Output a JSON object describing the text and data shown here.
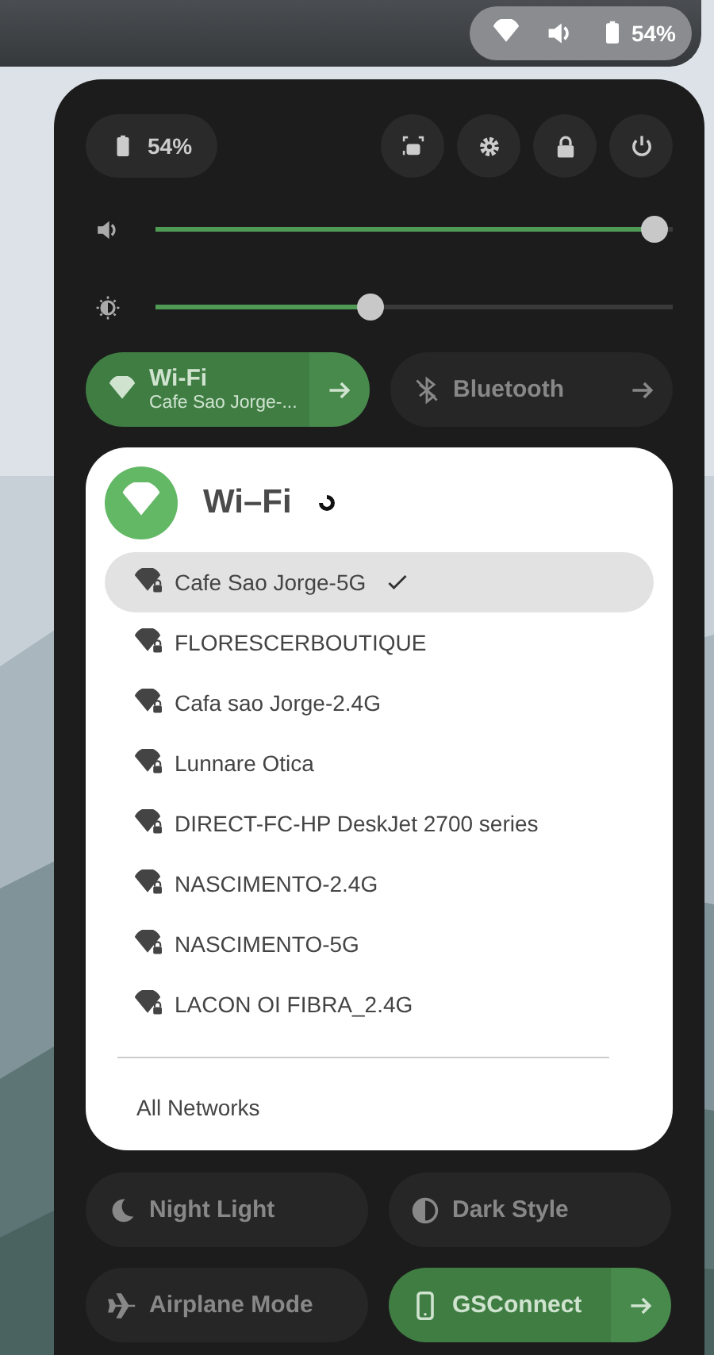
{
  "top_bar": {
    "battery": "54%"
  },
  "panel": {
    "battery": "54%",
    "volume": {
      "level": 0.99
    },
    "brightness": {
      "level": 0.41
    },
    "toggles": [
      {
        "kind": "menu",
        "label": "Wi-Fi",
        "subtitle": "Cafe Sao Jorge-...",
        "on": true,
        "expanded": true
      },
      {
        "kind": "menu",
        "label": "Bluetooth",
        "on": false,
        "expanded": false
      }
    ],
    "wifi_menu": {
      "title": "Wi–Fi",
      "busy": true,
      "networks": [
        {
          "name": "Cafe Sao Jorge-5G",
          "selected": true,
          "connected": true
        },
        {
          "name": "FLORESCERBOUTIQUE",
          "selected": false,
          "connected": false
        },
        {
          "name": "Cafa sao Jorge-2.4G",
          "selected": false,
          "connected": false
        },
        {
          "name": "Lunnare Otica",
          "selected": false,
          "connected": false
        },
        {
          "name": "DIRECT-FC-HP DeskJet 2700 series",
          "selected": false,
          "connected": false
        },
        {
          "name": "NASCIMENTO-2.4G",
          "selected": false,
          "connected": false
        },
        {
          "name": "NASCIMENTO-5G",
          "selected": false,
          "connected": false
        },
        {
          "name": "LACON OI FIBRA_2.4G",
          "selected": false,
          "connected": false
        }
      ],
      "footer": "All Networks"
    },
    "more_toggles": [
      {
        "kind": "plain",
        "label": "Night Light",
        "on": false
      },
      {
        "kind": "plain",
        "label": "Dark Style",
        "on": false
      },
      {
        "kind": "plain",
        "label": "Airplane Mode",
        "on": false
      },
      {
        "kind": "menu",
        "label": "GSConnect",
        "on": true,
        "expanded": false
      }
    ]
  }
}
